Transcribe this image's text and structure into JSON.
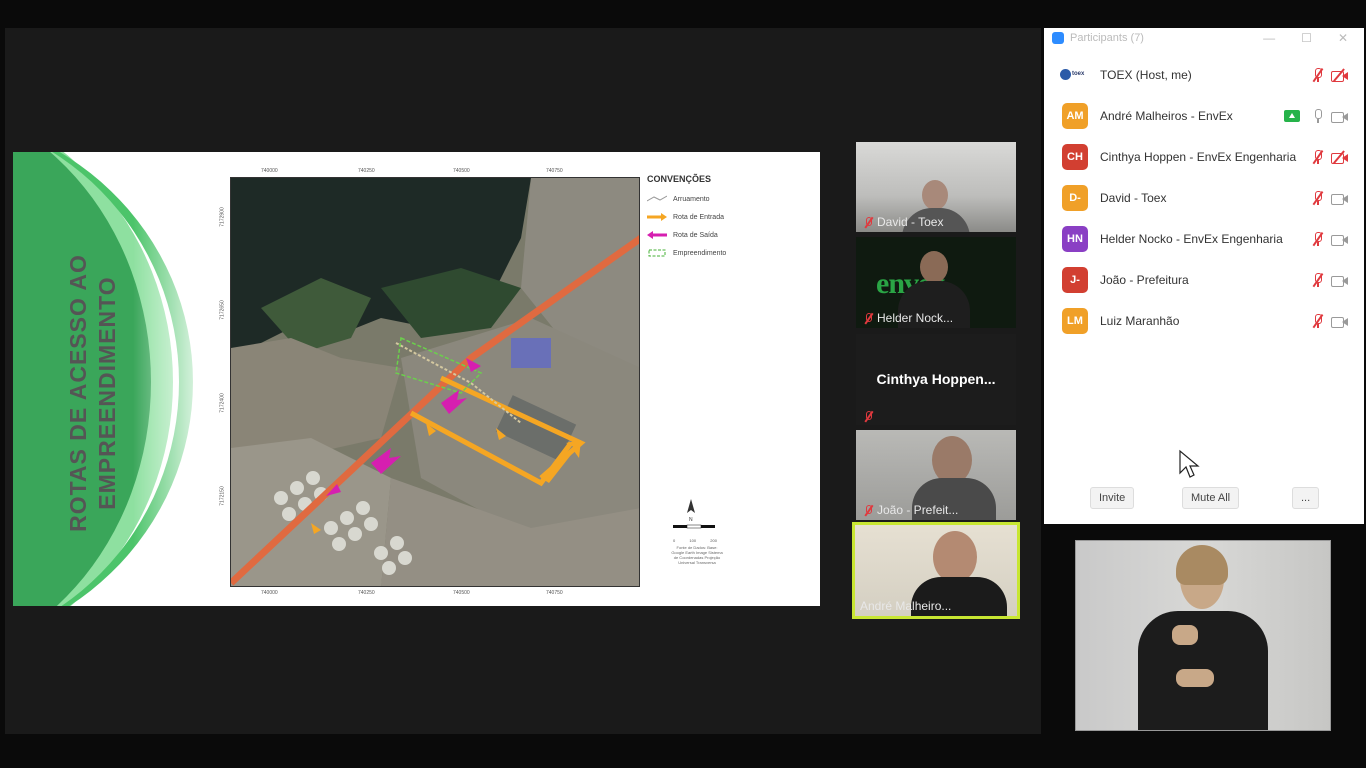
{
  "slide": {
    "title_line1": "ROTAS DE ACESSO AO",
    "title_line2": "EMPREENDIMENTO",
    "legend": {
      "title": "CONVENÇÕES",
      "items": [
        {
          "label": "Arruamento",
          "color": "#9a9a9a"
        },
        {
          "label": "Rota de Entrada",
          "color": "#f5a623"
        },
        {
          "label": "Rota de Saída",
          "color": "#d61fb0"
        },
        {
          "label": "Empreendimento",
          "color": "#45b035"
        }
      ]
    },
    "map_ticks_top": [
      "740000",
      "740250",
      "740500",
      "740750"
    ],
    "map_ticks_bottom": [
      "740000",
      "740250",
      "740500",
      "740750"
    ],
    "map_ticks_left": [
      "7172900",
      "7172650",
      "7172400",
      "7172150"
    ],
    "scale_labels": [
      "0",
      "100",
      "200"
    ],
    "source_text": "Fonte de Dados: Base: Google Earth Image Sistema de Coordenadas Projeção Universal Transversa"
  },
  "tiles": [
    {
      "name": "David - Toex",
      "muted": true
    },
    {
      "name": "Helder Nock...",
      "muted": true,
      "logo": "envex"
    },
    {
      "name": "Cinthya  Hoppen...",
      "muted": true
    },
    {
      "name": "João - Prefeit...",
      "muted": true
    },
    {
      "name": "André Malheiro...",
      "muted": false,
      "active": true
    }
  ],
  "panel": {
    "title": "Participants (7)",
    "window_controls": [
      "—",
      "☐",
      "✕"
    ],
    "participants": [
      {
        "name": "TOEX (Host, me)",
        "initials": "",
        "color": "#ffffff",
        "mic": "off",
        "cam": "off",
        "share": false
      },
      {
        "name": "André Malheiros - EnvEx",
        "initials": "AM",
        "color": "#f0a028",
        "mic": "on",
        "cam": "on",
        "share": true
      },
      {
        "name": "Cinthya Hoppen - EnvEx Engenharia",
        "initials": "CH",
        "color": "#d23f31",
        "mic": "off",
        "cam": "off",
        "share": false
      },
      {
        "name": "David - Toex",
        "initials": "D-",
        "color": "#f0a028",
        "mic": "off",
        "cam": "on",
        "share": false
      },
      {
        "name": "Helder Nocko - EnvEx Engenharia",
        "initials": "HN",
        "color": "#8a3fc4",
        "mic": "off",
        "cam": "on",
        "share": false
      },
      {
        "name": "João - Prefeitura",
        "initials": "J-",
        "color": "#d23f31",
        "mic": "off",
        "cam": "on",
        "share": false
      },
      {
        "name": "Luiz Maranhão",
        "initials": "LM",
        "color": "#f0a028",
        "mic": "off",
        "cam": "on",
        "share": false
      }
    ],
    "buttons": {
      "invite": "Invite",
      "mute_all": "Mute All",
      "more": "..."
    }
  }
}
